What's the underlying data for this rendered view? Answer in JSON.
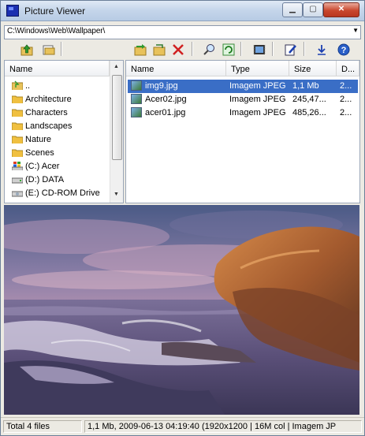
{
  "window": {
    "title": "Picture Viewer"
  },
  "path": {
    "value": "C:\\Windows\\Web\\Wallpaper\\"
  },
  "toolbar": {
    "icons": [
      "folder-up-icon",
      "open-folder-icon",
      "move-folder-icon",
      "copy-folder-icon",
      "delete-icon",
      "search-icon",
      "refresh-icon",
      "slideshow-icon",
      "edit-icon",
      "download-icon",
      "help-icon"
    ]
  },
  "folders": {
    "header": "Name",
    "items": [
      {
        "label": "..",
        "icon": "folder-up-icon"
      },
      {
        "label": "Architecture",
        "icon": "folder-icon"
      },
      {
        "label": "Characters",
        "icon": "folder-icon"
      },
      {
        "label": "Landscapes",
        "icon": "folder-icon"
      },
      {
        "label": "Nature",
        "icon": "folder-icon"
      },
      {
        "label": "Scenes",
        "icon": "folder-icon"
      },
      {
        "label": "(C:) Acer",
        "icon": "drive-windows-icon"
      },
      {
        "label": "(D:) DATA",
        "icon": "drive-icon"
      },
      {
        "label": "(E:) CD-ROM Drive",
        "icon": "cdrom-icon"
      }
    ]
  },
  "files": {
    "headers": {
      "name": "Name",
      "type": "Type",
      "size": "Size",
      "date": "D..."
    },
    "rows": [
      {
        "name": "img9.jpg",
        "type": "Imagem JPEG",
        "size": "1,1 Mb",
        "date": "2...",
        "selected": true
      },
      {
        "name": "Acer02.jpg",
        "type": "Imagem JPEG",
        "size": "245,47...",
        "date": "2...",
        "selected": false
      },
      {
        "name": "acer01.jpg",
        "type": "Imagem JPEG",
        "size": "485,26...",
        "date": "2...",
        "selected": false
      }
    ]
  },
  "status": {
    "left": "Total 4 files",
    "right": "1,1 Mb, 2009-06-13 04:19:40  (1920x1200 | 16M col | Imagem JP"
  },
  "colors": {
    "selection": "#3a6ec6",
    "folder": "#f0c040",
    "title_gradient": "#c4d5ea"
  }
}
